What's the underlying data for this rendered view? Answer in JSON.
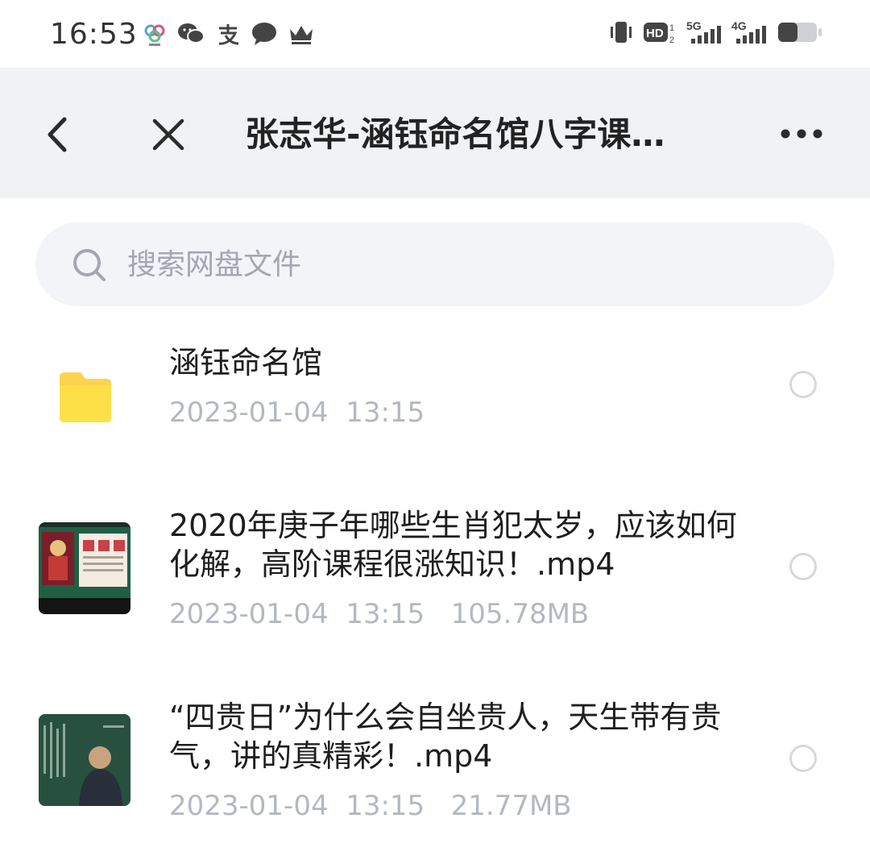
{
  "status_bar": {
    "time": "16:53",
    "app_icons": [
      "wheel-app-icon",
      "wechat-icon",
      "alipay-icon",
      "message-icon",
      "crown-icon"
    ],
    "indicators": [
      "vibrate-icon",
      "hd2-icon",
      "5g-signal-icon",
      "4g-signal-icon",
      "battery-icon"
    ],
    "hd_label": "HD",
    "net_5g": "5G",
    "net_4g": "4G"
  },
  "header": {
    "title": "张志华-涵钰命名馆八字课…"
  },
  "search": {
    "placeholder": "搜索网盘文件",
    "value": ""
  },
  "files": [
    {
      "name": "涵钰命名馆",
      "meta": "2023-01-04  13:15",
      "type": "folder",
      "icon": "folder-icon"
    },
    {
      "name": "2020年庚子年哪些生肖犯太岁，应该如何化解，高阶课程很涨知识！.mp4",
      "meta": "2023-01-04  13:15   105.78MB",
      "type": "video",
      "icon": "video-thumbnail"
    },
    {
      "name": "“四贵日”为什么会自坐贵人，天生带有贵气，讲的真精彩！.mp4",
      "meta": "2023-01-04  13:15   21.77MB",
      "type": "video",
      "icon": "video-thumbnail"
    }
  ],
  "colors": {
    "header_bg": "#f1f2f4",
    "folder": "#fcd34d",
    "meta_text": "#b4b8c0",
    "placeholder": "#a3a7b0"
  }
}
